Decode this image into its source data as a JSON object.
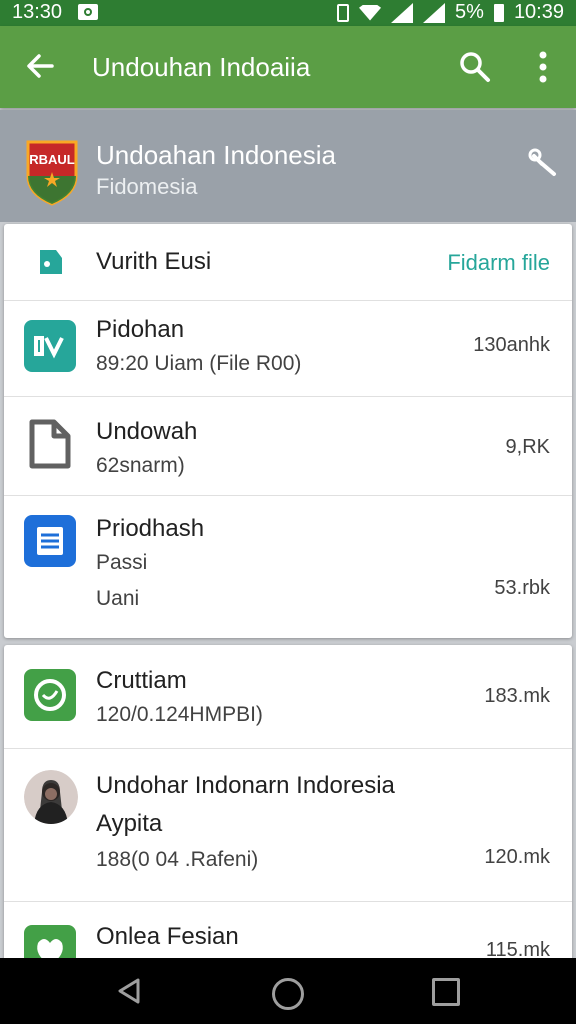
{
  "status_bar": {
    "time_left": "13:30",
    "battery": "5%",
    "time_right": "10:39"
  },
  "app_bar": {
    "title": "Undouhan Indoaiia",
    "icons": [
      "back-arrow-icon",
      "search-icon",
      "more-vert-icon"
    ]
  },
  "header": {
    "logo_text": "RBAUL",
    "title": "Undoahan Indonesia",
    "subtitle": "Fidomesia",
    "icon": "wrench-icon"
  },
  "section": {
    "label": "Vurith Eusi",
    "action": "Fidarm file"
  },
  "files_card1": [
    {
      "name": "Pidohan",
      "sub": "89:20 Uiam (File R00)",
      "size": "130anhk",
      "icon": "teal-app-icon"
    },
    {
      "name": "Undowah",
      "sub": "62snarm)",
      "size": "9,RK",
      "icon": "file-icon"
    },
    {
      "name": "Priodhash",
      "sub": "Passi",
      "sub2": "Uani",
      "size": "53.rbk",
      "icon": "doc-blue-icon"
    }
  ],
  "files_card2": [
    {
      "name": "Cruttiam",
      "sub": "120/0.124HMPBI)",
      "size": "183.mk",
      "icon": "green-circle-icon"
    },
    {
      "name": "Undohar Indonarn Indoresia",
      "sub": "Aypita",
      "sub2": "188(0 04 .Rafeni)",
      "size": "120.mk",
      "icon": "avatar-photo"
    },
    {
      "name": "Onlea Fesian",
      "size": "115.mk",
      "icon": "green-app-icon"
    }
  ],
  "colors": {
    "appbar": "#5b9e45",
    "statusbar": "#2e7d32",
    "accent_teal": "#26a69a",
    "header_bg": "#9aa1a9"
  }
}
